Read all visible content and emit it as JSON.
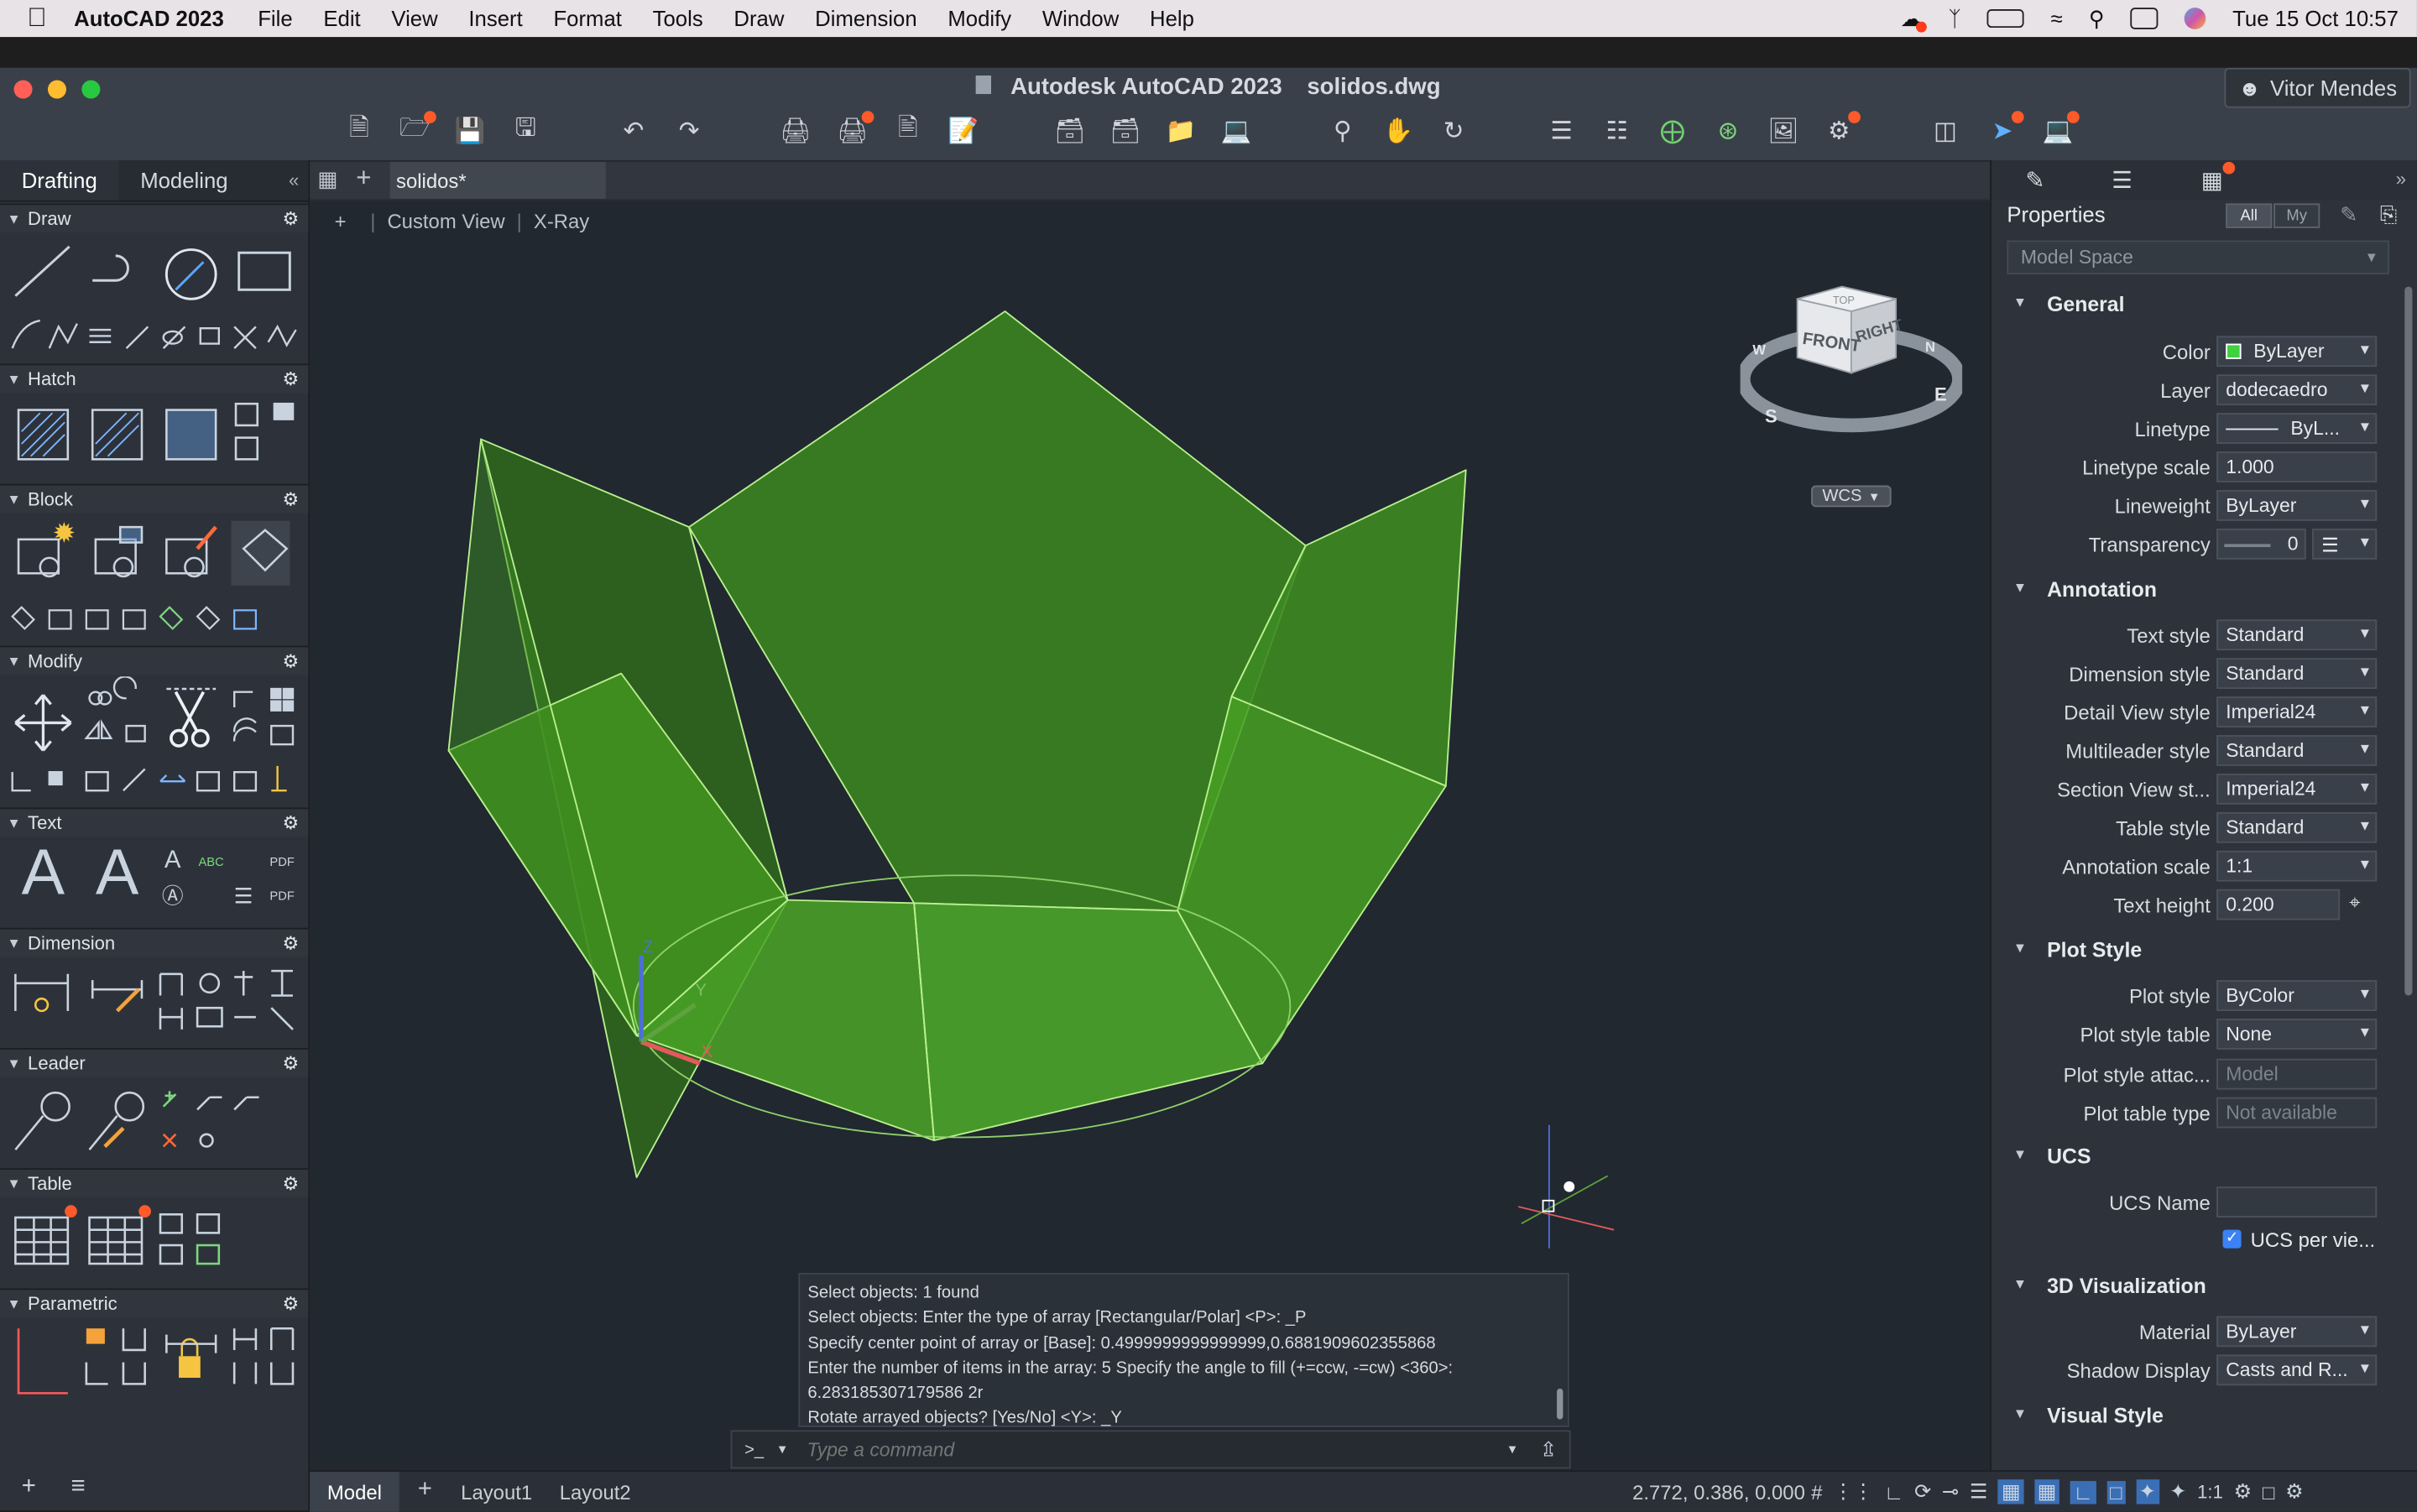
{
  "menubar": {
    "app_name": "AutoCAD 2023",
    "items": [
      "File",
      "Edit",
      "View",
      "Insert",
      "Format",
      "Tools",
      "Draw",
      "Dimension",
      "Modify",
      "Window",
      "Help"
    ],
    "clock": "Tue 15 Oct  10:57"
  },
  "window": {
    "app_title": "Autodesk AutoCAD 2023",
    "file_title": "solidos.dwg",
    "user": "Vitor Mendes"
  },
  "palette": {
    "tab_drafting": "Drafting",
    "tab_modeling": "Modeling",
    "sections": {
      "draw": "Draw",
      "hatch": "Hatch",
      "block": "Block",
      "modify": "Modify",
      "text": "Text",
      "dimension": "Dimension",
      "leader": "Leader",
      "table": "Table",
      "parametric": "Parametric"
    }
  },
  "drawing": {
    "file_tab": "solidos*",
    "view_plus": "+",
    "view_name": "Custom View",
    "visual_style": "X-Ray",
    "viewcube": {
      "front": "FRONT",
      "right": "RIGHT",
      "top": "TOP",
      "south": "S",
      "west": "W",
      "east": "E",
      "north": "N",
      "wcs": "WCS"
    },
    "ucs_x": "X",
    "ucs_y": "Y",
    "ucs_z": "Z"
  },
  "command": {
    "log": [
      "Select objects:   1 found",
      "Select objects: Enter the type of array [Rectangular/Polar] <P>: _P",
      "Specify center point of array or [Base]: 0.4999999999999999,0.6881909602355868",
      "Enter the number of items in the array: 5 Specify the angle to fill (+=ccw, -=cw) <360>:",
      "6.283185307179586 2r",
      "Rotate arrayed objects? [Yes/No] <Y>: _Y"
    ],
    "prompt_icon": ">_",
    "placeholder": "Type a command"
  },
  "status": {
    "tab_model": "Model",
    "tab_layout1": "Layout1",
    "tab_layout2": "Layout2",
    "coords": "2.772, 0.386, 0.000",
    "scale": "1:1"
  },
  "properties": {
    "title": "Properties",
    "filter_all": "All",
    "filter_my": "My",
    "selection": "Model Space",
    "categories": {
      "general": "General",
      "annotation": "Annotation",
      "plot_style": "Plot Style",
      "ucs": "UCS",
      "visualization": "3D Visualization",
      "visual_style": "Visual Style"
    },
    "general": {
      "color_label": "Color",
      "color_value": "ByLayer",
      "color_swatch": "#3fd13f",
      "layer_label": "Layer",
      "layer_value": "dodecaedro",
      "linetype_label": "Linetype",
      "linetype_value": "ByL...",
      "ltscale_label": "Linetype scale",
      "ltscale_value": "1.000",
      "lineweight_label": "Lineweight",
      "lineweight_value": "ByLayer",
      "transparency_label": "Transparency",
      "transparency_value": "0"
    },
    "annotation": {
      "textstyle_label": "Text style",
      "textstyle_value": "Standard",
      "dimstyle_label": "Dimension style",
      "dimstyle_value": "Standard",
      "detailview_label": "Detail View style",
      "detailview_value": "Imperial24",
      "mleader_label": "Multileader style",
      "mleader_value": "Standard",
      "sectionview_label": "Section View st...",
      "sectionview_value": "Imperial24",
      "tablestyle_label": "Table style",
      "tablestyle_value": "Standard",
      "annoscale_label": "Annotation scale",
      "annoscale_value": "1:1",
      "textheight_label": "Text height",
      "textheight_value": "0.200"
    },
    "plot": {
      "plotstyle_label": "Plot style",
      "plotstyle_value": "ByColor",
      "plottable_label": "Plot style table",
      "plottable_value": "None",
      "plotattach_label": "Plot style attac...",
      "plotattach_value": "Model",
      "plottype_label": "Plot table type",
      "plottype_value": "Not available"
    },
    "ucs": {
      "name_label": "UCS Name",
      "name_value": "",
      "perview_label": "UCS per vie..."
    },
    "viz": {
      "material_label": "Material",
      "material_value": "ByLayer",
      "shadow_label": "Shadow Display",
      "shadow_value": "Casts and R..."
    }
  },
  "colors": {
    "solid_fill": "#3f8f1f",
    "solid_edge": "#b9f08e",
    "notification": "#ff5a2a",
    "canvas": "#212830"
  }
}
